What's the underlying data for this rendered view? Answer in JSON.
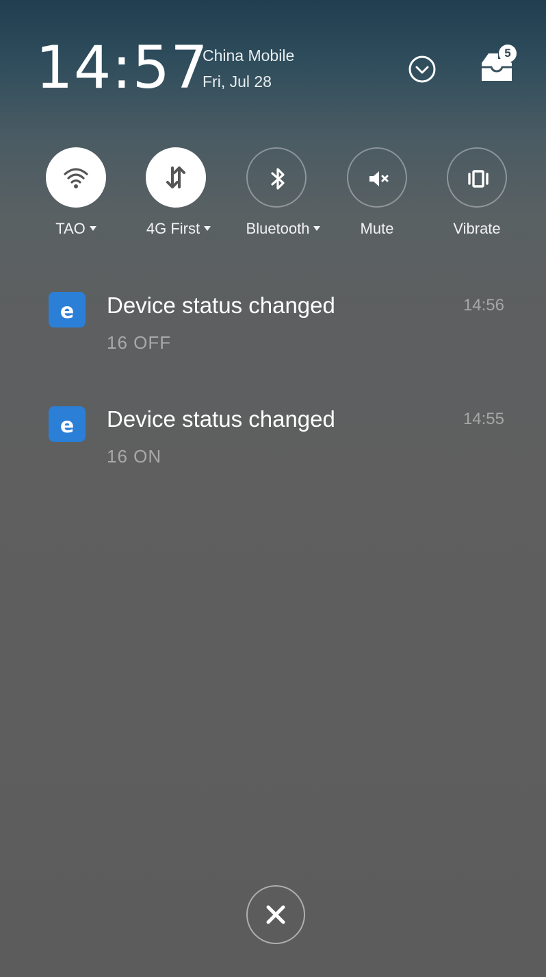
{
  "header": {
    "time": "14:57",
    "carrier": "China Mobile",
    "date": "Fri, Jul 28",
    "inbox_badge_count": "5",
    "expand_icon": "chevron-down-circle-icon",
    "inbox_icon": "notification-inbox-icon"
  },
  "toggles": [
    {
      "label": "TAO",
      "icon": "wifi-icon",
      "state": "on",
      "has_dropdown": true
    },
    {
      "label": "4G First",
      "icon": "mobile-data-icon",
      "state": "on",
      "has_dropdown": true
    },
    {
      "label": "Bluetooth",
      "icon": "bluetooth-icon",
      "state": "off",
      "has_dropdown": true
    },
    {
      "label": "Mute",
      "icon": "mute-icon",
      "state": "off",
      "has_dropdown": false
    },
    {
      "label": "Vibrate",
      "icon": "vibrate-icon",
      "state": "off",
      "has_dropdown": false
    }
  ],
  "notifications": [
    {
      "app_icon_letter": "e",
      "title": "Device status changed",
      "body": "16 OFF",
      "time": "14:56"
    },
    {
      "app_icon_letter": "e",
      "title": "Device status changed",
      "body": "16 ON",
      "time": "14:55"
    }
  ],
  "clear_all": {
    "icon": "close-icon"
  },
  "colors": {
    "app_icon": "#2b7fd6",
    "toggle_on": "#ffffff",
    "secondary_text": "#a9a9a9"
  }
}
